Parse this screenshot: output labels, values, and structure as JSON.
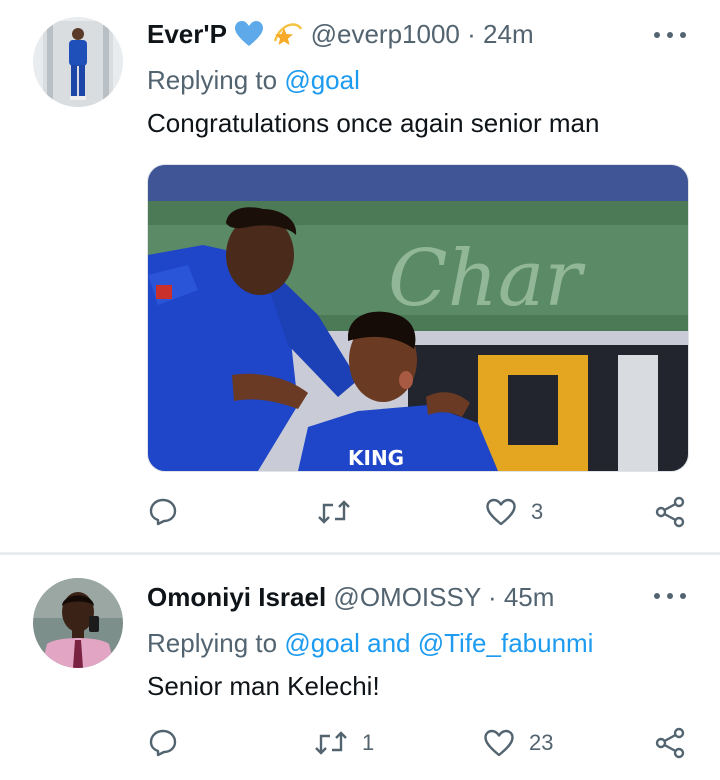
{
  "tweets": [
    {
      "display_name": "Ever'P",
      "name_emojis": [
        "blue-heart",
        "dizzy-star"
      ],
      "handle": "@everp1000",
      "separator": "·",
      "time": "24m",
      "replying_prefix": "Replying to",
      "replying_mentions": [
        "@goal"
      ],
      "text": "Congratulations once again senior man",
      "has_media": true,
      "stats": {
        "replies": "",
        "retweets": "",
        "likes": "3"
      }
    },
    {
      "display_name": "Omoniyi Israel",
      "handle": "@OMOISSY",
      "separator": "·",
      "time": "45m",
      "replying_prefix": "Replying to",
      "replying_mentions": [
        "@goal",
        "@Tife_fabunmi"
      ],
      "replying_joiner": "and",
      "text": "Senior man Kelechi!",
      "has_media": false,
      "stats": {
        "replies": "",
        "retweets": "1",
        "likes": "23"
      }
    }
  ],
  "colors": {
    "link": "#1d9bf0",
    "secondary": "#536471",
    "divider": "#e6ecf0",
    "jersey_blue": "#1f46c8"
  },
  "icons": [
    "more-icon",
    "reply-icon",
    "retweet-icon",
    "like-icon",
    "share-icon"
  ]
}
